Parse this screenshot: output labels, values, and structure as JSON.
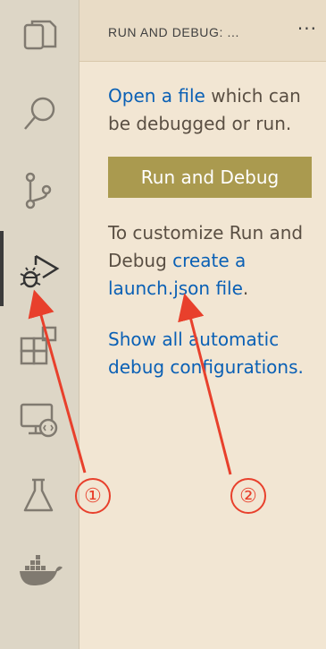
{
  "activity_bar": {
    "items": [
      {
        "icon": "files-icon"
      },
      {
        "icon": "search-icon"
      },
      {
        "icon": "source-control-icon"
      },
      {
        "icon": "run-debug-icon",
        "active": true
      },
      {
        "icon": "extensions-icon"
      },
      {
        "icon": "remote-explorer-icon"
      },
      {
        "icon": "testing-icon"
      },
      {
        "icon": "docker-icon"
      }
    ]
  },
  "sidebar": {
    "title": "RUN AND DEBUG: ...",
    "more_label": "···",
    "open_file_link": "Open a file",
    "open_file_rest": " which can be debugged or run.",
    "run_button_label": "Run and Debug",
    "customize_prefix": "To customize Run and Debug ",
    "create_launch_link": "create a launch.json file",
    "customize_suffix": ".",
    "show_all_link": "Show all automatic debug configurations."
  },
  "annotations": {
    "label_1": "①",
    "label_2": "②",
    "color": "#e8402c"
  }
}
